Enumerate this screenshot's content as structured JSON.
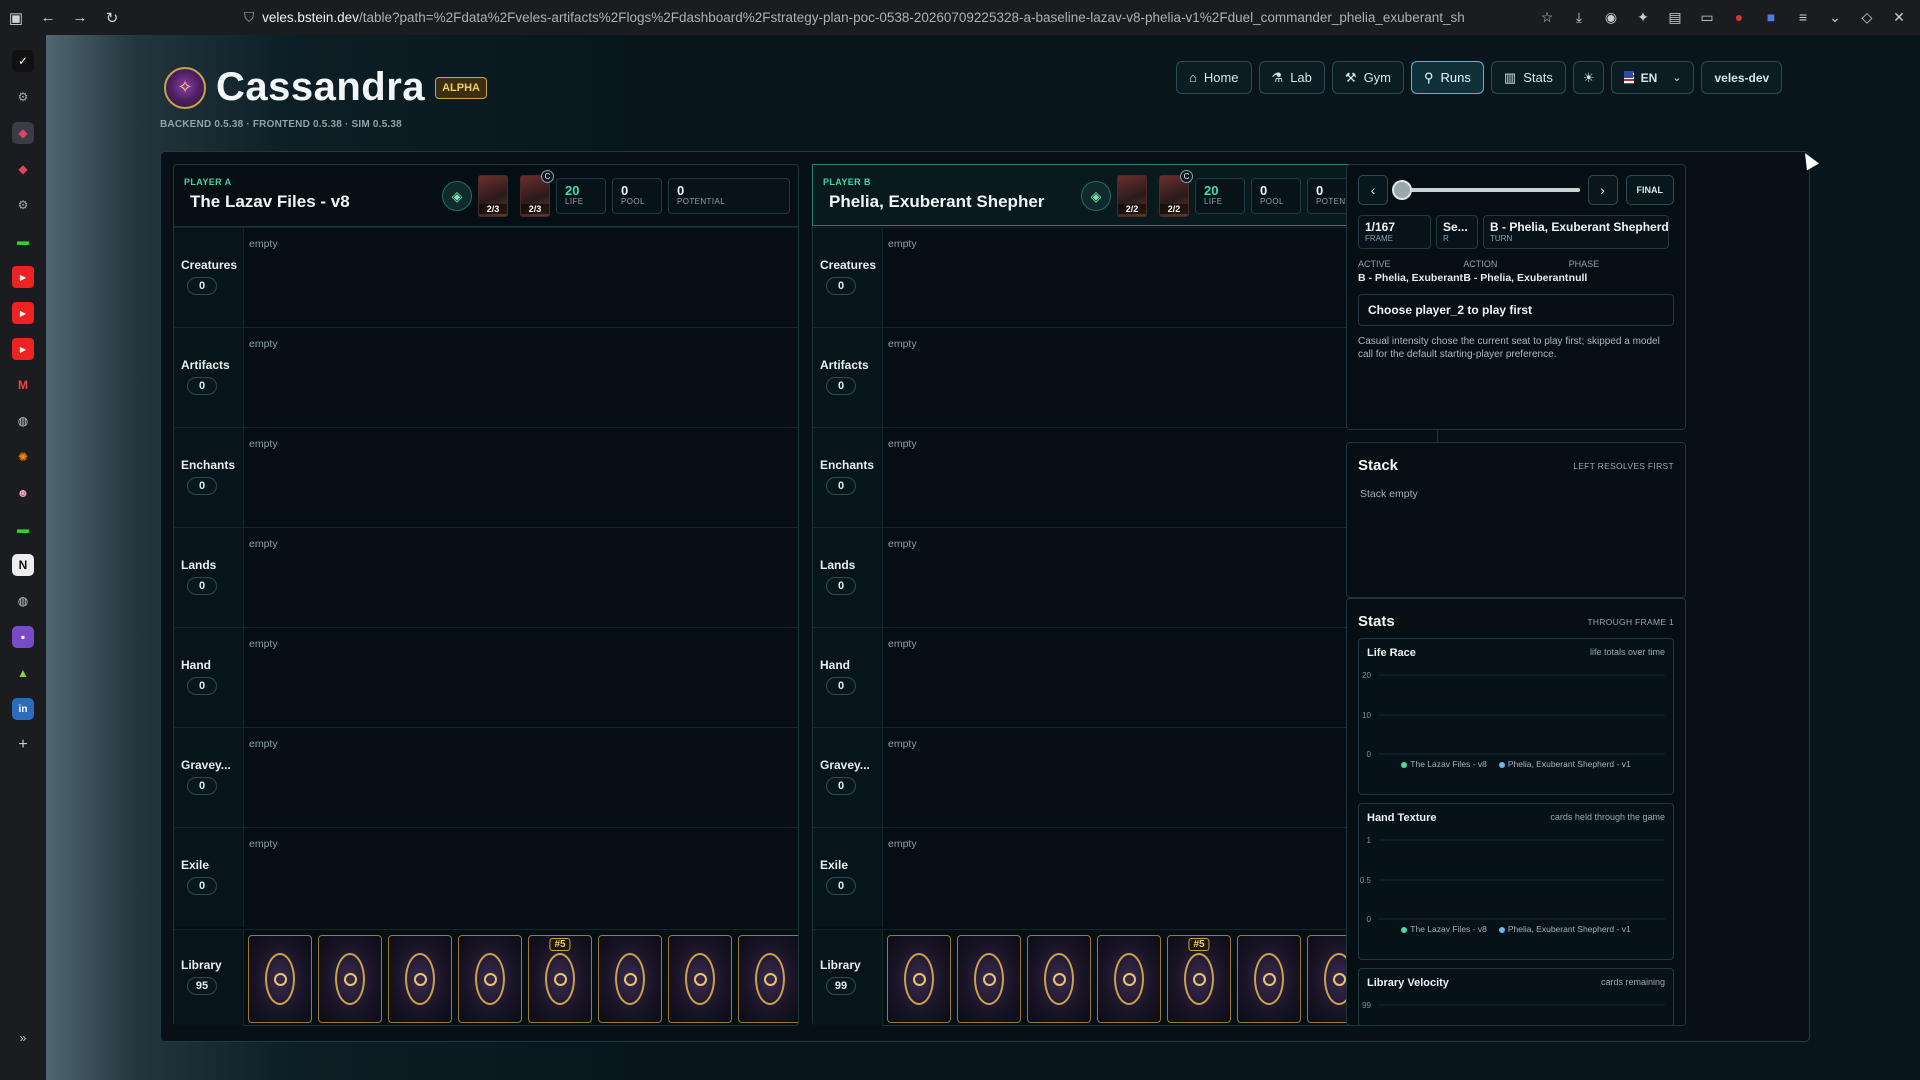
{
  "browser": {
    "url_host": "veles.bstein.dev",
    "url_path": "/table?path=%2Fdata%2Fveles-artifacts%2Flogs%2Fdashboard%2Fstrategy-plan-poc-0538-20260709225328-a-baseline-lazav-v8-phelia-v1%2Fduel_commander_phelia_exuberant_sh"
  },
  "sidebar_icons": [
    "check-icon",
    "gear-icon",
    "app-icon-active",
    "app-icon",
    "gear-icon",
    "green-app-icon",
    "youtube-icon",
    "youtube-icon",
    "youtube-icon",
    "gmail-icon",
    "globe-icon",
    "sun-icon",
    "avatar-icon",
    "green-app-icon",
    "notion-icon",
    "globe-icon",
    "purple-app-icon",
    "triangle-app-icon",
    "linkedin-icon"
  ],
  "app": {
    "title": "Cassandra",
    "badge": "ALPHA",
    "version": "BACKEND 0.5.38 · FRONTEND 0.5.38 · SIM 0.5.38"
  },
  "nav": {
    "home": "Home",
    "lab": "Lab",
    "gym": "Gym",
    "runs": "Runs",
    "stats": "Stats",
    "lang": "EN",
    "user": "veles-dev"
  },
  "players": {
    "a": {
      "label": "PLAYER A",
      "name": "The Lazav Files - v8",
      "cmd1": "2/3",
      "cmd2": "2/3",
      "life": "20",
      "life_label": "LIFE",
      "pool": "0",
      "pool_label": "POOL",
      "potential": "0",
      "potential_label": "POTENTIAL",
      "library": "95"
    },
    "b": {
      "label": "PLAYER B",
      "name": "Phelia, Exuberant Shepher",
      "cmd1": "2/2",
      "cmd2": "2/2",
      "life": "20",
      "life_label": "LIFE",
      "pool": "0",
      "pool_label": "POOL",
      "potential": "0",
      "potential_label": "POTENTIAL",
      "library": "99"
    }
  },
  "zones": {
    "creatures": "Creatures",
    "artifacts": "Artifacts",
    "enchants": "Enchants",
    "lands": "Lands",
    "hand": "Hand",
    "graveyard": "Gravey...",
    "exile": "Exile",
    "library": "Library",
    "zero": "0",
    "empty": "empty",
    "commander_mark": "C",
    "library_marker": "#5"
  },
  "replay": {
    "final": "FINAL",
    "frame": "1/167",
    "frame_label": "FRAME",
    "seat": "Se...",
    "seat_label": "R",
    "turn": "B - Phelia, Exuberant Shepherd",
    "turn_label": "TURN",
    "active_label": "ACTIVE",
    "active": "B - Phelia, Exuberant",
    "action_label": "ACTION",
    "action": "B - Phelia, Exuberant",
    "phase_label": "PHASE",
    "phase": "null",
    "decision": "Choose player_2 to play first",
    "reason": "Casual intensity chose the current seat to play first; skipped a model call for the default starting-player preference."
  },
  "stack": {
    "title": "Stack",
    "hint": "LEFT RESOLVES FIRST",
    "empty": "Stack empty"
  },
  "stats": {
    "title": "Stats",
    "hint": "THROUGH FRAME 1",
    "life_race": {
      "title": "Life Race",
      "hint": "life totals over time",
      "ticks": [
        "20",
        "10",
        "0"
      ]
    },
    "hand_texture": {
      "title": "Hand Texture",
      "hint": "cards held through the game",
      "ticks": [
        "1",
        "0.5",
        "0"
      ]
    },
    "library_velocity": {
      "title": "Library Velocity",
      "hint": "cards remaining",
      "ticks": [
        "99"
      ]
    },
    "legend_a": "The Lazav Files - v8",
    "legend_b": "Phelia, Exuberant Shepherd - v1",
    "color_a": "#3ee0a3",
    "color_b": "#6fb6e8"
  }
}
